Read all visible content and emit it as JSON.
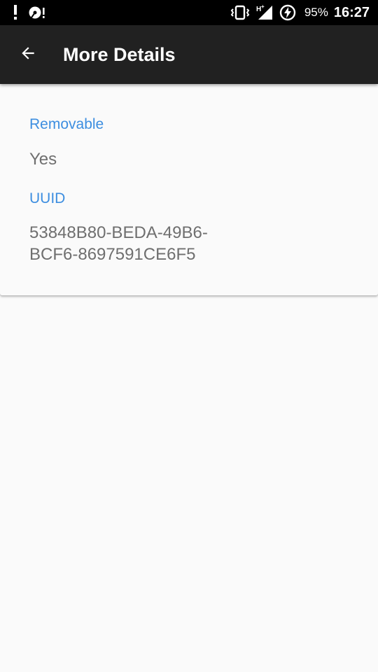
{
  "status_bar": {
    "left_icons": [
      "alert-icon",
      "sd-card-alert-icon"
    ],
    "right_icons": [
      "vibrate-icon",
      "hplus-signal-icon",
      "battery-charging-icon"
    ],
    "battery": "95%",
    "time": "16:27"
  },
  "toolbar": {
    "title": "More Details",
    "back_icon": "arrow-back-icon"
  },
  "details": [
    {
      "label": "Removable",
      "value": "Yes"
    },
    {
      "label": "UUID",
      "value": "53848B80-BEDA-49B6-BCF6-8697591CE6F5"
    }
  ],
  "colors": {
    "status_bar_bg": "#000000",
    "toolbar_bg": "#212121",
    "page_bg": "#fafafa",
    "label_accent": "#3d8ee0",
    "value_text": "#6f6f6f"
  }
}
